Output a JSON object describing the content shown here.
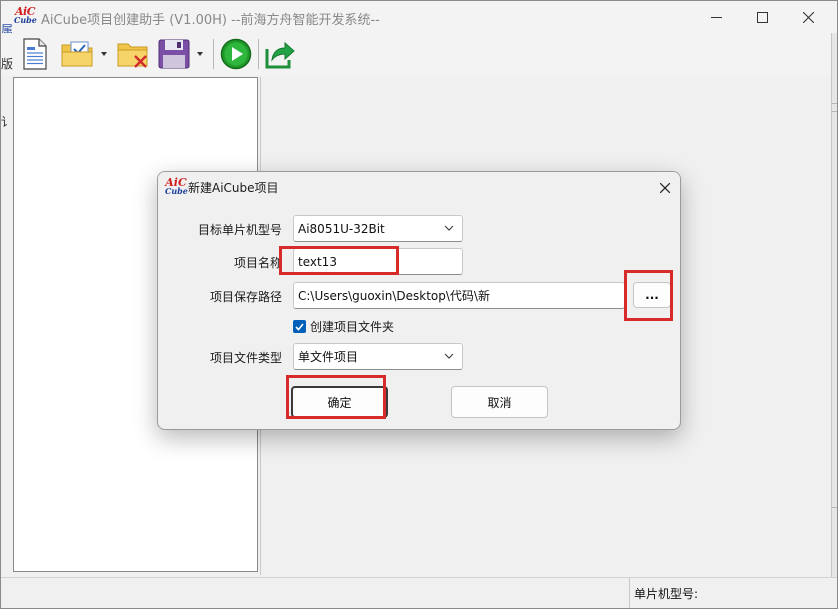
{
  "app": {
    "logo_line1": "AiC",
    "logo_line2": "Cube",
    "title": "AiCube项目创建助手 (V1.00H) --前海方舟智能开发系统--"
  },
  "toolbar": {
    "icons": [
      "new-document-icon",
      "open-folder-checklist-icon",
      "close-project-icon",
      "save-disk-icon",
      "run-play-icon",
      "export-arrow-icon"
    ],
    "edge_text_1": "版",
    "edge_text_2": "属",
    "edge_text_3": "讠"
  },
  "statusbar": {
    "mcu_label": "单片机型号:"
  },
  "dialog": {
    "title": "新建AiCube项目",
    "mcu_label": "目标单片机型号",
    "mcu_value": "Ai8051U-32Bit",
    "name_label": "项目名称",
    "name_value": "text13",
    "path_label": "项目保存路径",
    "path_value": "C:\\Users\\guoxin\\Desktop\\代码\\新",
    "browse_label": "...",
    "create_folder_label": "创建项目文件夹",
    "create_folder_checked": true,
    "type_label": "项目文件类型",
    "type_value": "单文件项目",
    "ok_label": "确定",
    "cancel_label": "取消"
  },
  "colors": {
    "highlight": "#d72b2b",
    "checkbox_accent": "#005fb8",
    "logo_red": "#d01e1e",
    "logo_blue": "#1b3d9c"
  }
}
